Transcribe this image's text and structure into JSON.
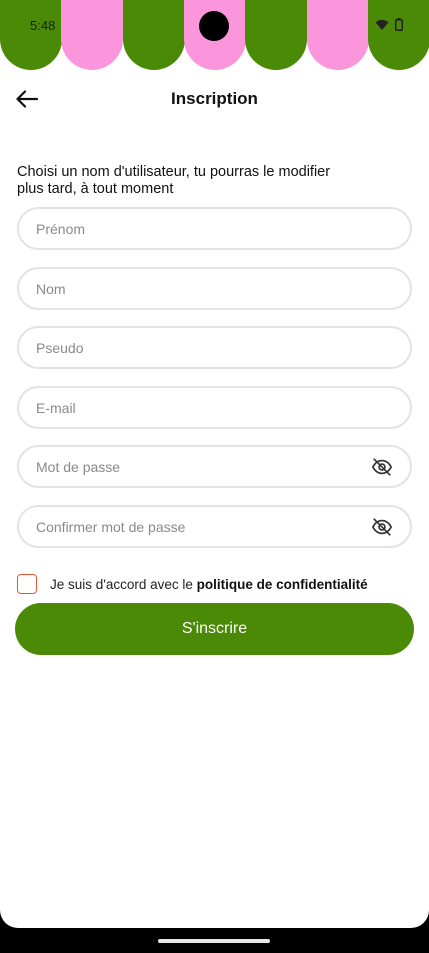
{
  "status": {
    "time": "5:48"
  },
  "colors": {
    "green": "#4a8a06",
    "pink": "#fb96dc",
    "checkbox_border": "#e2592f"
  },
  "header": {
    "title": "Inscription",
    "back_icon": "arrow-left-icon"
  },
  "intro_text": "Choisi un nom d'utilisateur, tu pourras le modifier plus tard, à tout moment",
  "fields": {
    "first_name_placeholder": "Prénom",
    "last_name_placeholder": "Nom",
    "username_placeholder": "Pseudo",
    "email_placeholder": "E-mail",
    "password_placeholder": "Mot de passe",
    "confirm_password_placeholder": "Confirmer mot de passe",
    "visibility_icon": "eye-off-icon"
  },
  "consent": {
    "text": "Je suis d'accord avec le ",
    "link": "politique de confidentialité",
    "checked": false
  },
  "submit_label": "S'inscrire"
}
